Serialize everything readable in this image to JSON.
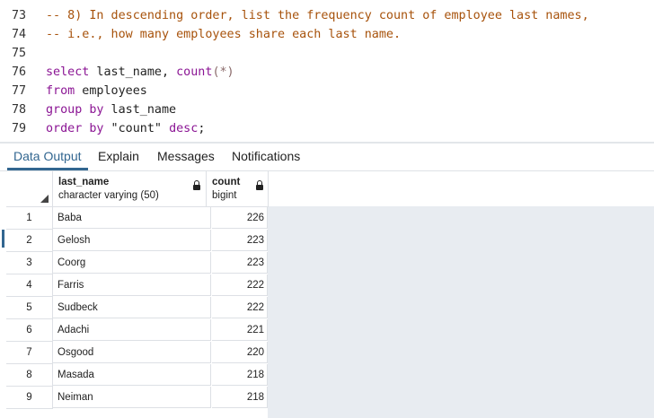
{
  "editor": {
    "lines": [
      {
        "num": "73",
        "parts": [
          {
            "cls": "cm",
            "text": "-- 8) In descending order, list the frequency count of employee last names,"
          }
        ]
      },
      {
        "num": "74",
        "parts": [
          {
            "cls": "cm",
            "text": "-- i.e., how many employees share each last name."
          }
        ]
      },
      {
        "num": "75",
        "parts": []
      },
      {
        "num": "76",
        "parts": [
          {
            "cls": "kw",
            "text": "select"
          },
          {
            "cls": "pl",
            "text": " last_name, "
          },
          {
            "cls": "fn",
            "text": "count"
          },
          {
            "cls": "op",
            "text": "(*)"
          }
        ]
      },
      {
        "num": "77",
        "parts": [
          {
            "cls": "kw",
            "text": "from"
          },
          {
            "cls": "pl",
            "text": " employees"
          }
        ]
      },
      {
        "num": "78",
        "parts": [
          {
            "cls": "kw",
            "text": "group by"
          },
          {
            "cls": "pl",
            "text": " last_name"
          }
        ]
      },
      {
        "num": "79",
        "parts": [
          {
            "cls": "kw",
            "text": "order by"
          },
          {
            "cls": "str",
            "text": " \"count\" "
          },
          {
            "cls": "kw",
            "text": "desc"
          },
          {
            "cls": "pl",
            "text": ";"
          }
        ]
      }
    ]
  },
  "tabs": [
    {
      "label": "Data Output",
      "active": true
    },
    {
      "label": "Explain",
      "active": false
    },
    {
      "label": "Messages",
      "active": false
    },
    {
      "label": "Notifications",
      "active": false
    }
  ],
  "columns": [
    {
      "name": "last_name",
      "type": "character varying (50)"
    },
    {
      "name": "count",
      "type": "bigint"
    }
  ],
  "rows": [
    {
      "num": "1",
      "last_name": "Baba",
      "count": "226"
    },
    {
      "num": "2",
      "last_name": "Gelosh",
      "count": "223"
    },
    {
      "num": "3",
      "last_name": "Coorg",
      "count": "223"
    },
    {
      "num": "4",
      "last_name": "Farris",
      "count": "222"
    },
    {
      "num": "5",
      "last_name": "Sudbeck",
      "count": "222"
    },
    {
      "num": "6",
      "last_name": "Adachi",
      "count": "221"
    },
    {
      "num": "7",
      "last_name": "Osgood",
      "count": "220"
    },
    {
      "num": "8",
      "last_name": "Masada",
      "count": "218"
    },
    {
      "num": "9",
      "last_name": "Neiman",
      "count": "218"
    }
  ],
  "colors": {
    "comment": "#a7520b",
    "keyword": "#8b1594",
    "active_tab": "#326690",
    "grid_empty": "#e8ecf1"
  }
}
